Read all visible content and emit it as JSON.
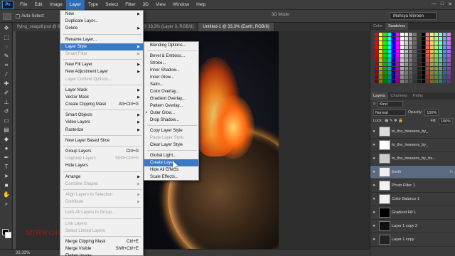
{
  "menubar": {
    "logo": "Ps",
    "items": [
      "File",
      "Edit",
      "Image",
      "Layer",
      "Type",
      "Select",
      "Filter",
      "3D",
      "View",
      "Window",
      "Help"
    ],
    "active_item": "Layer",
    "window_buttons": [
      "—",
      "□",
      "✕"
    ]
  },
  "options_bar": {
    "auto_select_label": "Auto-Select:",
    "mode_3d_label": "3D Mode:",
    "workspace_value": "Muhsya Mirroen"
  },
  "tabs": [
    {
      "label": "flying_seagull.psd @ 66,7%",
      "active": false
    },
    {
      "label": "planet_3_0_by_fragile_stock.psd @ 33,3% (Layer 3, RGB/8)",
      "active": false
    },
    {
      "label": "Untitled-1 @ 33,3% (Earth, RGB/8)",
      "active": true
    }
  ],
  "layer_menu": {
    "items": [
      {
        "label": "New",
        "arrow": true
      },
      {
        "label": "Duplicate Layer..."
      },
      {
        "label": "Delete",
        "arrow": true
      },
      {
        "sep": true
      },
      {
        "label": "Rename Layer..."
      },
      {
        "label": "Layer Style",
        "arrow": true,
        "highlight": true
      },
      {
        "label": "Smart Filter",
        "disabled": true,
        "arrow": true
      },
      {
        "sep": true
      },
      {
        "label": "New Fill Layer",
        "arrow": true
      },
      {
        "label": "New Adjustment Layer",
        "arrow": true
      },
      {
        "label": "Layer Content Options...",
        "disabled": true
      },
      {
        "sep": true
      },
      {
        "label": "Layer Mask",
        "arrow": true
      },
      {
        "label": "Vector Mask",
        "arrow": true
      },
      {
        "label": "Create Clipping Mask",
        "shortcut": "Alt+Ctrl+G"
      },
      {
        "sep": true
      },
      {
        "label": "Smart Objects",
        "arrow": true
      },
      {
        "label": "Video Layers",
        "arrow": true
      },
      {
        "label": "Rasterize",
        "arrow": true
      },
      {
        "sep": true
      },
      {
        "label": "New Layer Based Slice"
      },
      {
        "sep": true
      },
      {
        "label": "Group Layers",
        "shortcut": "Ctrl+G"
      },
      {
        "label": "Ungroup Layers",
        "disabled": true,
        "shortcut": "Shift+Ctrl+G"
      },
      {
        "label": "Hide Layers"
      },
      {
        "sep": true
      },
      {
        "label": "Arrange",
        "arrow": true
      },
      {
        "label": "Combine Shapes",
        "disabled": true,
        "arrow": true
      },
      {
        "sep": true
      },
      {
        "label": "Align Layers to Selection",
        "disabled": true,
        "arrow": true
      },
      {
        "label": "Distribute",
        "disabled": true,
        "arrow": true
      },
      {
        "sep": true
      },
      {
        "label": "Lock All Layers in Group...",
        "disabled": true
      },
      {
        "sep": true
      },
      {
        "label": "Link Layers",
        "disabled": true
      },
      {
        "label": "Select Linked Layers",
        "disabled": true
      },
      {
        "sep": true
      },
      {
        "label": "Merge Clipping Mask",
        "shortcut": "Ctrl+E"
      },
      {
        "label": "Merge Visible",
        "shortcut": "Shift+Ctrl+E"
      },
      {
        "label": "Flatten Image"
      }
    ]
  },
  "style_menu": {
    "items": [
      {
        "label": "Blending Options..."
      },
      {
        "sep": true
      },
      {
        "label": "Bevel & Emboss..."
      },
      {
        "label": "Stroke..."
      },
      {
        "label": "Inner Shadow..."
      },
      {
        "label": "Inner Glow..."
      },
      {
        "label": "Satin..."
      },
      {
        "label": "Color Overlay..."
      },
      {
        "label": "Gradient Overlay..."
      },
      {
        "label": "Pattern Overlay..."
      },
      {
        "label": "Outer Glow...",
        "checked": true
      },
      {
        "label": "Drop Shadow..."
      },
      {
        "sep": true
      },
      {
        "label": "Copy Layer Style"
      },
      {
        "label": "Paste Layer Style",
        "disabled": true
      },
      {
        "label": "Clear Layer Style"
      },
      {
        "sep": true
      },
      {
        "label": "Global Light..."
      },
      {
        "label": "Create Layer",
        "highlight": true
      },
      {
        "label": "Hide All Effects"
      },
      {
        "label": "Scale Effects..."
      }
    ]
  },
  "panels": {
    "top_tabs": [
      "Color",
      "Swatches"
    ],
    "layer_tabs": [
      "Layers",
      "Channels",
      "Paths"
    ],
    "kind_label": "Kind",
    "blend_mode": "Normal",
    "opacity_label": "Opacity:",
    "opacity_value": "100%",
    "lock_label": "Lock:",
    "fill_label": "Fill:",
    "fill_value": "100%",
    "layers": [
      {
        "name": "to_the_heavens_by_",
        "thumb": "#dddddd",
        "selected": false
      },
      {
        "name": "to_the_heavens_by_",
        "thumb": "#ffffff",
        "selected": false
      },
      {
        "name": "to_the_heavens_by_fra...",
        "thumb": "#cccccc",
        "selected": false
      },
      {
        "name": "Earth",
        "thumb": "#eeeeee",
        "selected": true,
        "fx": "fx"
      },
      {
        "name": "Photo Filter 1",
        "thumb": "#f2f2f2",
        "selected": false
      },
      {
        "name": "Color Balance 1",
        "thumb": "#f2f2f2",
        "selected": false
      },
      {
        "name": "Gradient Fill 1",
        "thumb": "#000000",
        "selected": false
      },
      {
        "name": "Layer 1 copy 2",
        "thumb": "#111111",
        "selected": false
      },
      {
        "name": "Layer 1 copy",
        "thumb": "#222222",
        "selected": false
      }
    ]
  },
  "status": {
    "zoom": "33,33%"
  },
  "watermark": "MIRROR",
  "colors": {
    "accent": "#3a79c6",
    "menu_bg": "#f0f0f0",
    "ui_dark": "#3b3b3b",
    "swatches": [
      "#ff0000",
      "#ffff00",
      "#00ff00",
      "#00ffff",
      "#0000ff",
      "#ff00ff",
      "#ffffff",
      "#cccccc",
      "#999999",
      "#666666",
      "#333333",
      "#000000",
      "#ff6666",
      "#ffcc66",
      "#99ff66",
      "#66ffcc",
      "#6699ff",
      "#cc66ff"
    ]
  }
}
